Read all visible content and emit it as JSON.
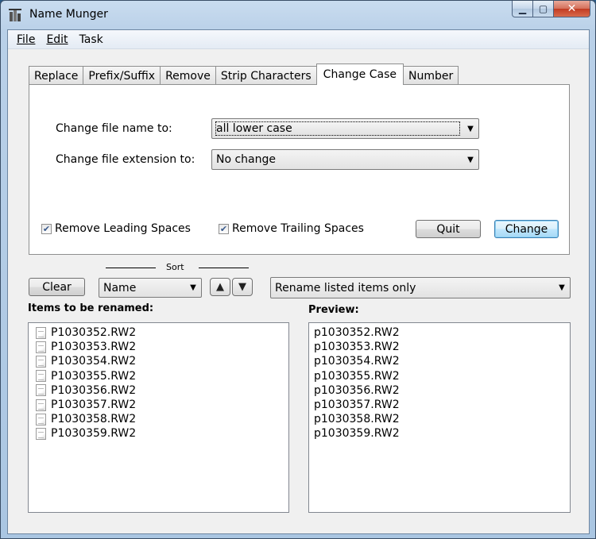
{
  "window": {
    "title": "Name Munger"
  },
  "menu": [
    "File",
    "Edit",
    "Task"
  ],
  "tabs": [
    "Replace",
    "Prefix/Suffix",
    "Remove",
    "Strip Characters",
    "Change Case",
    "Number"
  ],
  "active_tab": "Change Case",
  "change_case": {
    "name_label": "Change file name to:",
    "name_value": "all lower case",
    "ext_label": "Change file extension to:",
    "ext_value": "No change",
    "leading_label": "Remove Leading Spaces",
    "leading_checked": true,
    "trailing_label": "Remove Trailing Spaces",
    "trailing_checked": true,
    "quit_label": "Quit",
    "change_label": "Change"
  },
  "controls": {
    "clear_label": "Clear",
    "sort_label": "Sort",
    "sort_value": "Name",
    "scope_value": "Rename listed items only",
    "up_glyph": "▲",
    "down_glyph": "▼"
  },
  "items_label": "Items to be renamed:",
  "preview_label": "Preview:",
  "items": [
    "P1030352.RW2",
    "P1030353.RW2",
    "P1030354.RW2",
    "P1030355.RW2",
    "P1030356.RW2",
    "P1030357.RW2",
    "P1030358.RW2",
    "P1030359.RW2"
  ],
  "preview": [
    "p1030352.RW2",
    "p1030353.RW2",
    "p1030354.RW2",
    "p1030355.RW2",
    "p1030356.RW2",
    "p1030357.RW2",
    "p1030358.RW2",
    "p1030359.RW2"
  ],
  "colors": {
    "titlebar": "#b9d0e8",
    "close_button": "#c23b22",
    "default_button": "#3c7fb1"
  }
}
